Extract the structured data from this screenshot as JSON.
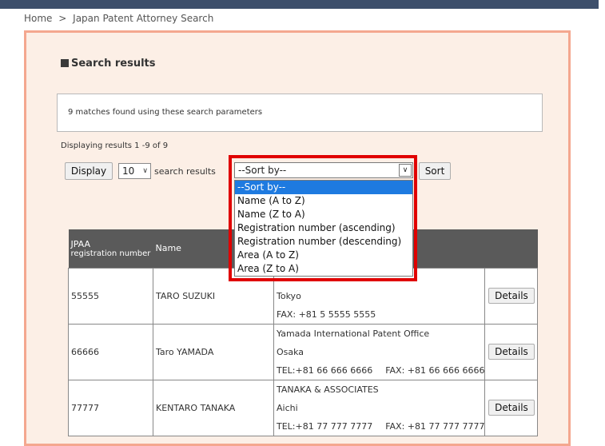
{
  "breadcrumb": {
    "home": "Home",
    "separator": ">",
    "current": "Japan Patent Attorney Search"
  },
  "results": {
    "title": "Search results",
    "matches_text": "9 matches found using these search parameters",
    "displaying_text": "Displaying results 1 -9 of 9"
  },
  "controls": {
    "display_label": "Display",
    "count_value": "10",
    "per_page_label": "search results",
    "sort_value": "--Sort by--",
    "sort_button_label": "Sort",
    "sort_options": [
      "--Sort by--",
      "Name (A to Z)",
      "Name (Z to A)",
      "Registration number (ascending)",
      "Registration number (descending)",
      "Area (A to Z)",
      "Area (Z to A)"
    ]
  },
  "table": {
    "headers": {
      "reg_line1": "JPAA",
      "reg_line2": "registration number",
      "name": "Name"
    },
    "rows": [
      {
        "reg": "55555",
        "name": "TARO SUZUKI",
        "office": "",
        "area": "Tokyo",
        "tel": "",
        "fax": "FAX: +81 5 5555 5555",
        "details": "Details"
      },
      {
        "reg": "66666",
        "name": "Taro YAMADA",
        "office": "Yamada International Patent Office",
        "area": "Osaka",
        "tel": "TEL:+81 66 666 6666",
        "fax": "FAX: +81 66 666 6666",
        "details": "Details"
      },
      {
        "reg": "77777",
        "name": "KENTARO TANAKA",
        "office": "TANAKA & ASSOCIATES",
        "area": "Aichi",
        "tel": "TEL:+81 77 777 7777",
        "fax": "FAX: +81 77 777 7777",
        "details": "Details"
      }
    ]
  },
  "colors": {
    "highlight": "#e00000",
    "panel_border": "#f4a78f",
    "panel_bg": "#fcefe6",
    "selected_option": "#1e7ae0"
  }
}
